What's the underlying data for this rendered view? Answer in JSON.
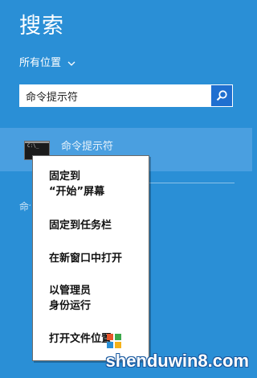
{
  "panel": {
    "title": "搜索",
    "scope_label": "所有位置"
  },
  "search": {
    "value": "命令提示符"
  },
  "result": {
    "label": "命令提示符",
    "icon_text": "C:\\_"
  },
  "ghost_label": "命令提示符",
  "context_menu": {
    "items": [
      {
        "line1": "固定到",
        "line2": "“开始”屏幕"
      },
      {
        "line1": "固定到任务栏",
        "line2": ""
      },
      {
        "line1": "在新窗口中打开",
        "line2": ""
      },
      {
        "line1": "以管理员",
        "line2": "身份运行"
      },
      {
        "line1": "打开文件位置",
        "line2": ""
      }
    ]
  },
  "watermark": "shenduwin8.com",
  "colors": {
    "background": "#2a8fd6",
    "selected_result": "#4a9fe0",
    "search_button": "#1f6fd0",
    "menu_background": "#ffffff"
  },
  "icons": {
    "scope": "chevron-down-icon",
    "search_button": "search-icon",
    "result": "command-prompt-icon"
  }
}
